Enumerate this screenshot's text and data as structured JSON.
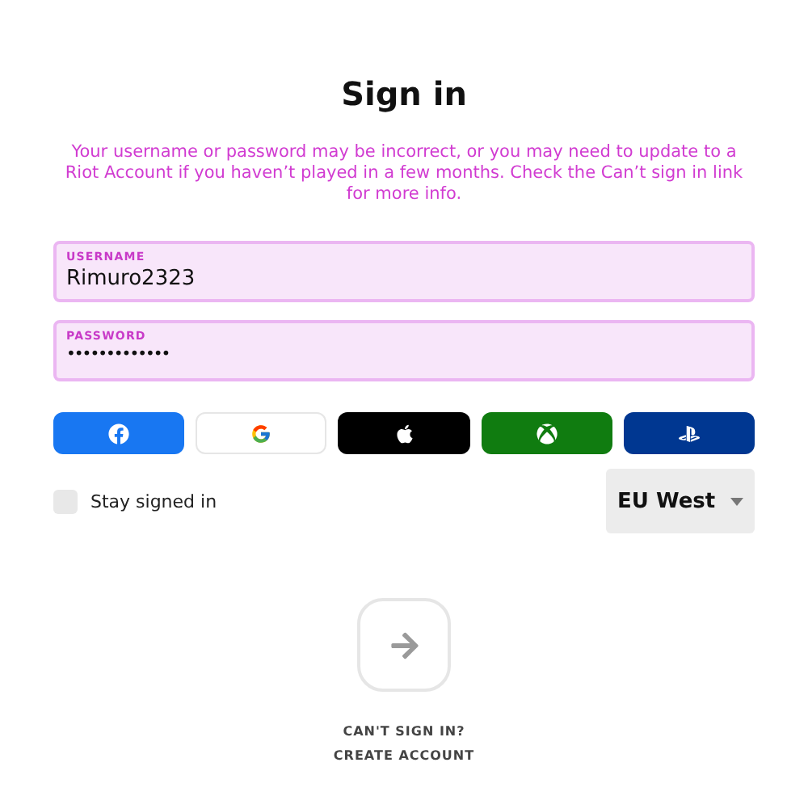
{
  "title": "Sign in",
  "error": "Your username or password may be incorrect, or you may need to update to a Riot Account if you haven’t played in a few months. Check the Can’t sign in link for more info.",
  "fields": [
    {
      "label": "USERNAME",
      "value": "Rimuro2323",
      "kind": "text"
    },
    {
      "label": "PASSWORD",
      "value": "•••••••••••••",
      "kind": "password"
    }
  ],
  "providers": [
    {
      "kind": "facebook",
      "color": "#1877f2"
    },
    {
      "kind": "google",
      "color": "#ffffff"
    },
    {
      "kind": "apple",
      "color": "#000000"
    },
    {
      "kind": "xbox",
      "color": "#107c10"
    },
    {
      "kind": "playstation",
      "color": "#003791"
    }
  ],
  "stay_signed_in": {
    "label": "Stay signed in",
    "checked": false
  },
  "region": {
    "value": "EU West"
  },
  "links": [
    "CAN'T SIGN IN?",
    "CREATE ACCOUNT"
  ]
}
